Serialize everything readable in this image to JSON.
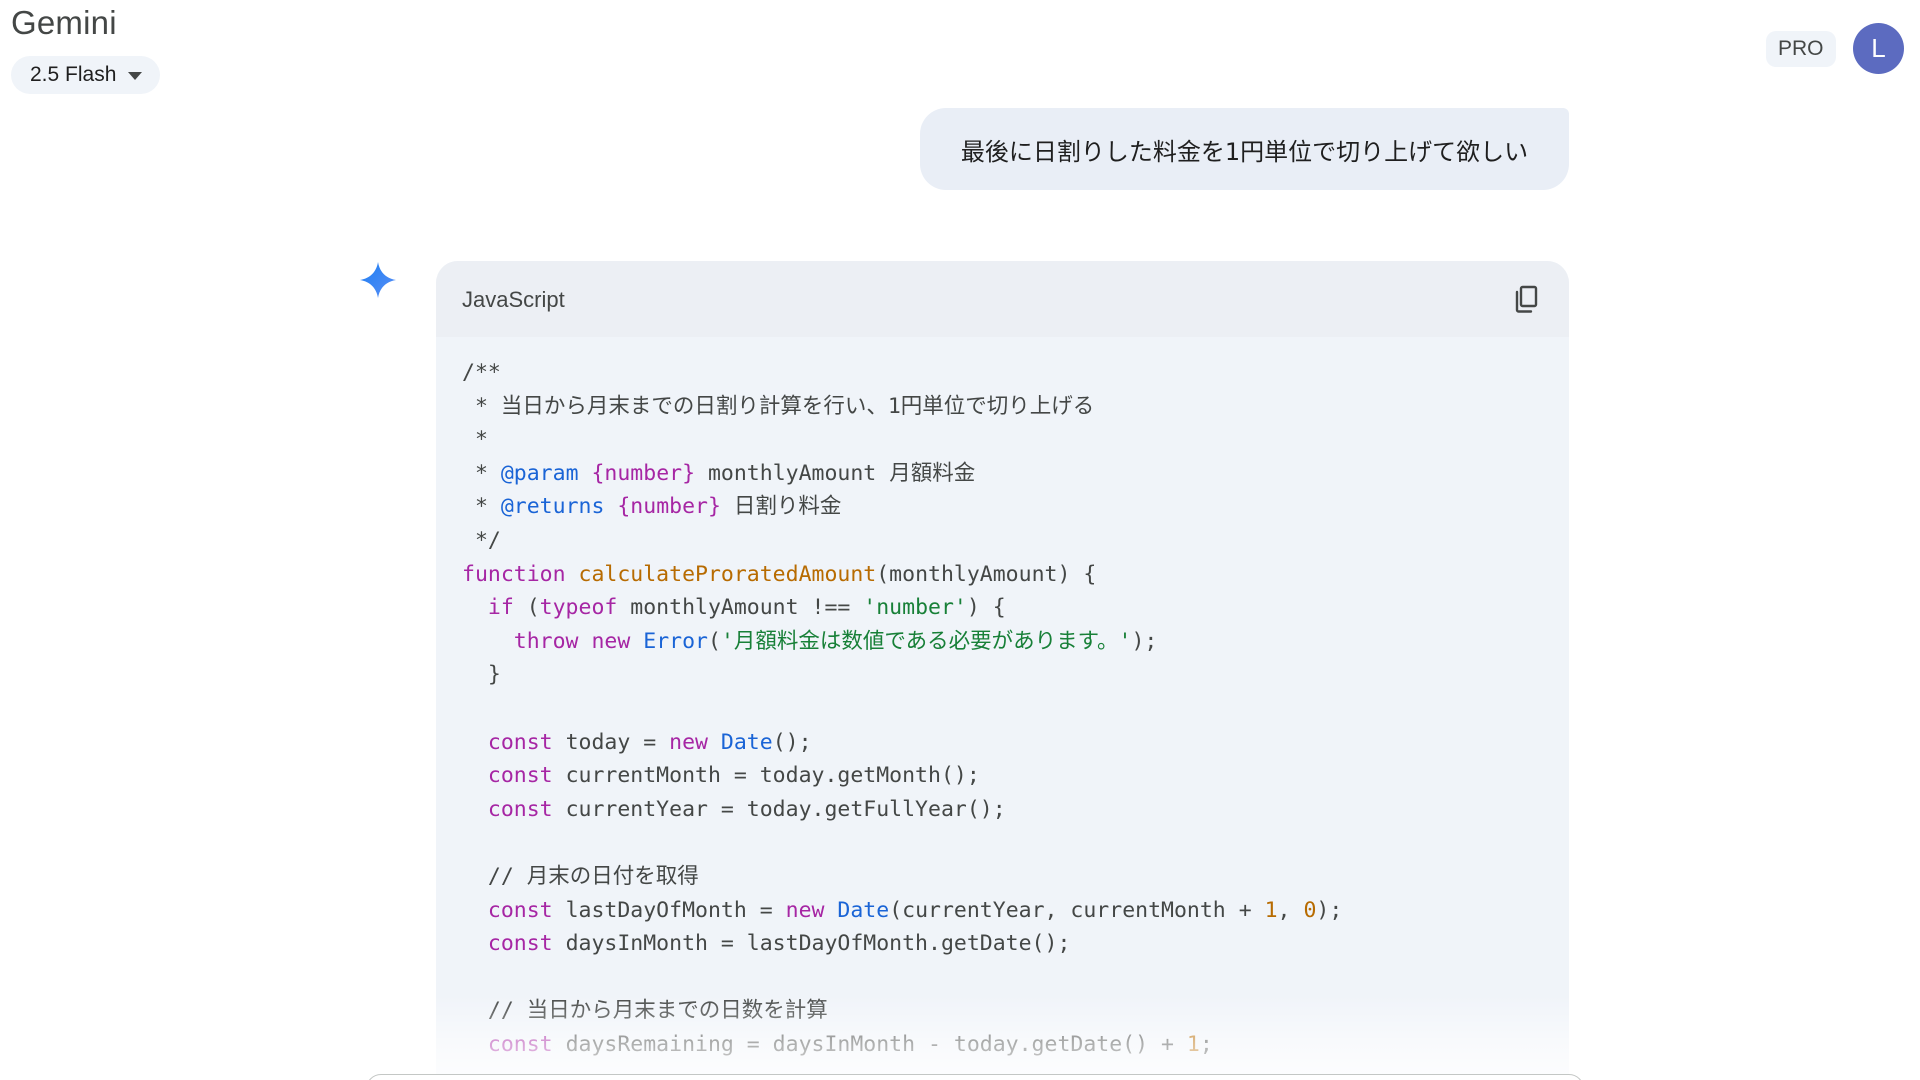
{
  "header": {
    "app_title": "Gemini",
    "model_label": "2.5 Flash",
    "plan_badge": "PRO",
    "avatar_initial": "L"
  },
  "conversation": {
    "user_message": "最後に日割りした料金を1円単位で切り上げて欲しい",
    "code_block": {
      "language": "JavaScript",
      "lines": [
        [
          {
            "t": "/**",
            "c": "cm"
          }
        ],
        [
          {
            "t": " * 当日から月末までの日割り計算を行い、1円単位で切り上げる",
            "c": "cm"
          }
        ],
        [
          {
            "t": " *",
            "c": "cm"
          }
        ],
        [
          {
            "t": " * ",
            "c": "cm"
          },
          {
            "t": "@param",
            "c": "tag"
          },
          {
            "t": " ",
            "c": "cm"
          },
          {
            "t": "{number}",
            "c": "type"
          },
          {
            "t": " monthlyAmount 月額料金",
            "c": "cm"
          }
        ],
        [
          {
            "t": " * ",
            "c": "cm"
          },
          {
            "t": "@returns",
            "c": "tag"
          },
          {
            "t": " ",
            "c": "cm"
          },
          {
            "t": "{number}",
            "c": "type"
          },
          {
            "t": " 日割り料金",
            "c": "cm"
          }
        ],
        [
          {
            "t": " */",
            "c": "cm"
          }
        ],
        [
          {
            "t": "function",
            "c": "kw"
          },
          {
            "t": " ",
            "c": ""
          },
          {
            "t": "calculateProratedAmount",
            "c": "fn"
          },
          {
            "t": "(monthlyAmount) {",
            "c": ""
          }
        ],
        [
          {
            "t": "  ",
            "c": ""
          },
          {
            "t": "if",
            "c": "kw"
          },
          {
            "t": " (",
            "c": ""
          },
          {
            "t": "typeof",
            "c": "kw"
          },
          {
            "t": " monthlyAmount !== ",
            "c": ""
          },
          {
            "t": "'number'",
            "c": "str"
          },
          {
            "t": ") {",
            "c": ""
          }
        ],
        [
          {
            "t": "    ",
            "c": ""
          },
          {
            "t": "throw",
            "c": "kw"
          },
          {
            "t": " ",
            "c": ""
          },
          {
            "t": "new",
            "c": "kw"
          },
          {
            "t": " ",
            "c": ""
          },
          {
            "t": "Error",
            "c": "cls"
          },
          {
            "t": "(",
            "c": ""
          },
          {
            "t": "'月額料金は数値である必要があります。'",
            "c": "str"
          },
          {
            "t": ");",
            "c": ""
          }
        ],
        [
          {
            "t": "  }",
            "c": ""
          }
        ],
        [
          {
            "t": "",
            "c": ""
          }
        ],
        [
          {
            "t": "  ",
            "c": ""
          },
          {
            "t": "const",
            "c": "kw"
          },
          {
            "t": " today = ",
            "c": ""
          },
          {
            "t": "new",
            "c": "kw"
          },
          {
            "t": " ",
            "c": ""
          },
          {
            "t": "Date",
            "c": "cls"
          },
          {
            "t": "();",
            "c": ""
          }
        ],
        [
          {
            "t": "  ",
            "c": ""
          },
          {
            "t": "const",
            "c": "kw"
          },
          {
            "t": " currentMonth = today.getMonth();",
            "c": ""
          }
        ],
        [
          {
            "t": "  ",
            "c": ""
          },
          {
            "t": "const",
            "c": "kw"
          },
          {
            "t": " currentYear = today.getFullYear();",
            "c": ""
          }
        ],
        [
          {
            "t": "",
            "c": ""
          }
        ],
        [
          {
            "t": "  // 月末の日付を取得",
            "c": "cm"
          }
        ],
        [
          {
            "t": "  ",
            "c": ""
          },
          {
            "t": "const",
            "c": "kw"
          },
          {
            "t": " lastDayOfMonth = ",
            "c": ""
          },
          {
            "t": "new",
            "c": "kw"
          },
          {
            "t": " ",
            "c": ""
          },
          {
            "t": "Date",
            "c": "cls"
          },
          {
            "t": "(currentYear, currentMonth + ",
            "c": ""
          },
          {
            "t": "1",
            "c": "num"
          },
          {
            "t": ", ",
            "c": ""
          },
          {
            "t": "0",
            "c": "num"
          },
          {
            "t": ");",
            "c": ""
          }
        ],
        [
          {
            "t": "  ",
            "c": ""
          },
          {
            "t": "const",
            "c": "kw"
          },
          {
            "t": " daysInMonth = lastDayOfMonth.getDate();",
            "c": ""
          }
        ],
        [
          {
            "t": "",
            "c": ""
          }
        ],
        [
          {
            "t": "  // 当日から月末までの日数を計算",
            "c": "cm"
          }
        ],
        [
          {
            "t": "  ",
            "c": ""
          },
          {
            "t": "const",
            "c": "kw"
          },
          {
            "t": " daysRemaining = daysInMonth - today.getDate() + ",
            "c": ""
          },
          {
            "t": "1",
            "c": "num"
          },
          {
            "t": ";",
            "c": ""
          }
        ]
      ]
    }
  },
  "icons": {
    "sparkle": "gemini-sparkle-icon",
    "copy": "copy-icon",
    "caret": "caret-down-icon"
  },
  "colors": {
    "sparkle_blue": "#4285f4",
    "keyword": "#a626a4",
    "function": "#b76b01",
    "class": "#1a64d6",
    "string": "#188038",
    "avatar": "#5c6bc0"
  }
}
